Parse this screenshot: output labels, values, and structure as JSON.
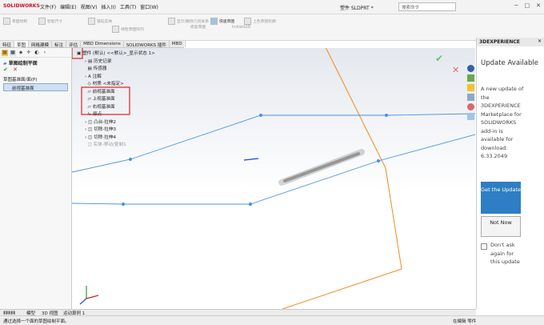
{
  "app": {
    "logo": "SOLIDWORKS",
    "menu": [
      "文件(F)",
      "编辑(E)",
      "视图(V)",
      "插入(I)",
      "工具(T)",
      "窗口(W)"
    ],
    "doc_title": "塑件 SLDPRT *",
    "search_placeholder": "搜索命令"
  },
  "toolbar": {
    "groups": [
      {
        "label": "草图绘制"
      },
      {
        "label": "智能尺寸"
      },
      {
        "label": "镜向实体"
      },
      {
        "label": "线性草图阵列"
      },
      {
        "label": "显示/删除几何关系"
      },
      {
        "label": "修复草图"
      },
      {
        "label": "快速草图"
      },
      {
        "label": "Instant2D"
      },
      {
        "label": "上色草图轮廓"
      }
    ],
    "quick_sketch": "快速草图"
  },
  "cmd_tabs": [
    "特征",
    "草图",
    "网格建模",
    "标注",
    "评估",
    "MBD Dimensions",
    "SOLIDWORKS 插件",
    "MBD"
  ],
  "left_panel": {
    "title": "草图绘制平面",
    "section": "草图基准面/面(P)",
    "selected": "前视基准面"
  },
  "tree": {
    "root": "塑件 (默认) <<默认>_显示状态 1>",
    "items": [
      "历史记录",
      "传感器",
      "注解",
      "材质 <未指定>",
      "前视基准面",
      "上视基准面",
      "右视基准面",
      "原点",
      "凸台-拉伸2",
      "切除-拉伸3",
      "切除-拉伸4",
      "实体-移动/复制1"
    ]
  },
  "right_pane": {
    "header": "3DEXPERIENCE",
    "title": "Update Available",
    "body": "A new update of the 3DEXPERIENCE Marketplace for SOLIDWORKS add-in is available for download: 6.33.2049",
    "get_button": "Get the Update",
    "not_now": "Not Now",
    "dont_ask": "Don't ask again for this update"
  },
  "bottom_tabs": [
    "模型",
    "3D 视图",
    "运动算例 1"
  ],
  "status": {
    "left": "通过选择一个面的草图绘制平面。",
    "right": "在编辑 零件"
  },
  "colors": {
    "plane": "#4a90e2",
    "orange": "#f08a24",
    "highlight": "#e02020",
    "accent": "#2d7ec4"
  }
}
